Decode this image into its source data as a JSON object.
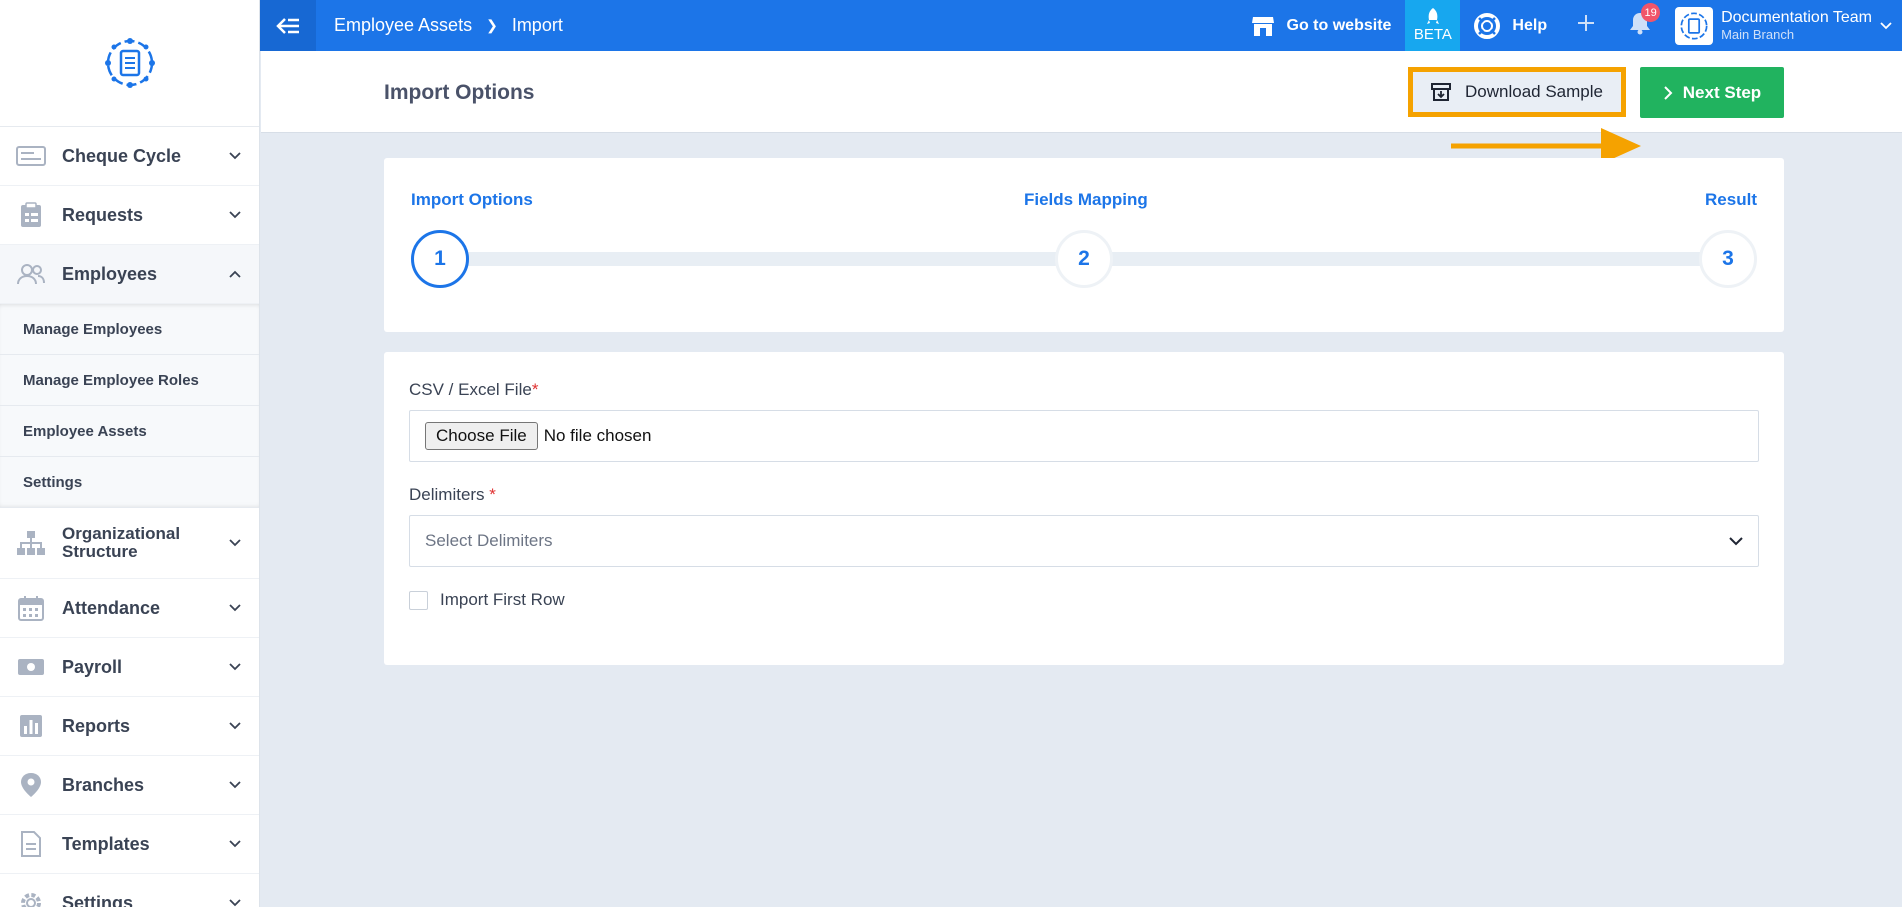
{
  "topbar": {
    "breadcrumb": [
      "Employee Assets",
      "Import"
    ],
    "go_to_website": "Go to website",
    "beta": "BETA",
    "help": "Help",
    "notification_count": "19",
    "user_name": "Documentation Team",
    "user_branch": "Main Branch"
  },
  "sidebar": {
    "items": [
      {
        "label": "Cheque Cycle",
        "icon": "cheque-icon"
      },
      {
        "label": "Requests",
        "icon": "clipboard-icon"
      },
      {
        "label": "Employees",
        "icon": "users-icon"
      },
      {
        "label": "Organizational Structure",
        "icon": "org-chart-icon"
      },
      {
        "label": "Attendance",
        "icon": "calendar-icon"
      },
      {
        "label": "Payroll",
        "icon": "money-icon"
      },
      {
        "label": "Reports",
        "icon": "bar-chart-icon"
      },
      {
        "label": "Branches",
        "icon": "map-pin-icon"
      },
      {
        "label": "Templates",
        "icon": "document-icon"
      },
      {
        "label": "Settings",
        "icon": "gear-icon"
      }
    ],
    "employees_submenu": [
      "Manage Employees",
      "Manage Employee Roles",
      "Employee Assets",
      "Settings"
    ]
  },
  "page": {
    "title": "Import Options",
    "download_sample": "Download Sample",
    "next_step": "Next Step"
  },
  "stepper": {
    "steps": [
      {
        "label": "Import Options",
        "number": "1"
      },
      {
        "label": "Fields Mapping",
        "number": "2"
      },
      {
        "label": "Result",
        "number": "3"
      }
    ]
  },
  "form": {
    "file_label": "CSV / Excel File",
    "required_mark": "*",
    "choose_file": "Choose File",
    "file_status": "No file chosen",
    "delimiters_label": "Delimiters",
    "delimiters_placeholder": "Select Delimiters",
    "import_first_row": "Import First Row"
  },
  "colors": {
    "primary": "#1c75e8",
    "success": "#21b35f",
    "highlight": "#f5a200"
  }
}
